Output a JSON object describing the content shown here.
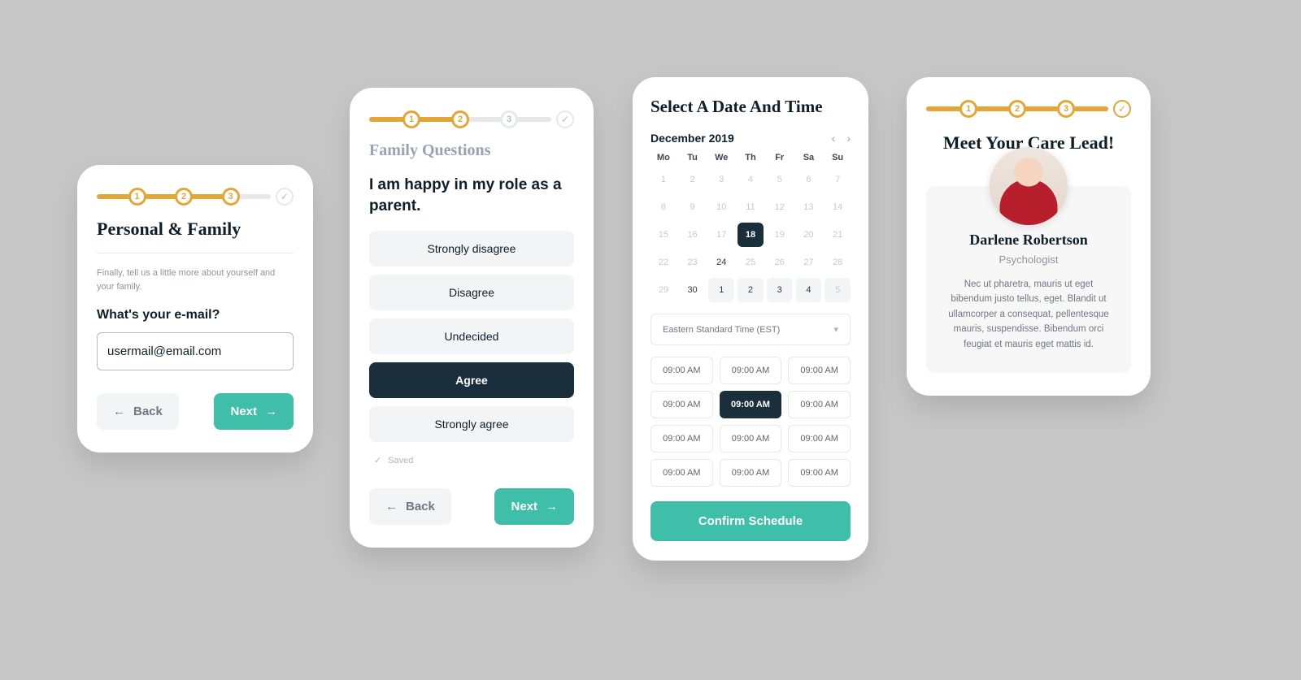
{
  "progress": {
    "s1": "1",
    "s2": "2",
    "s3": "3"
  },
  "nav": {
    "back": "Back",
    "next": "Next"
  },
  "card1": {
    "title": "Personal & Family",
    "subtitle": "Finally, tell us a little more about yourself and your family.",
    "question": "What's your e-mail?",
    "email": "usermail@email.com"
  },
  "card2": {
    "title": "Family Questions",
    "statement": "I am happy in my role as a parent.",
    "options": [
      "Strongly disagree",
      "Disagree",
      "Undecided",
      "Agree",
      "Strongly agree"
    ],
    "selected": 3,
    "saved": "Saved"
  },
  "card3": {
    "title": "Select A Date And Time",
    "month": "December 2019",
    "dow": [
      "Mo",
      "Tu",
      "We",
      "Th",
      "Fr",
      "Sa",
      "Su"
    ],
    "weeks": [
      [
        {
          "n": 1,
          "s": "dim"
        },
        {
          "n": 2,
          "s": "dim"
        },
        {
          "n": 3,
          "s": "dim"
        },
        {
          "n": 4,
          "s": "dim"
        },
        {
          "n": 5,
          "s": "dim"
        },
        {
          "n": 6,
          "s": "dim"
        },
        {
          "n": 7,
          "s": "dim"
        }
      ],
      [
        {
          "n": 8,
          "s": "dim"
        },
        {
          "n": 9,
          "s": "dim"
        },
        {
          "n": 10,
          "s": "dim"
        },
        {
          "n": 11,
          "s": "dim"
        },
        {
          "n": 12,
          "s": "dim"
        },
        {
          "n": 13,
          "s": "dim"
        },
        {
          "n": 14,
          "s": "dim"
        }
      ],
      [
        {
          "n": 15,
          "s": "dim"
        },
        {
          "n": 16,
          "s": "dim"
        },
        {
          "n": 17,
          "s": "dim"
        },
        {
          "n": 18,
          "s": "sel"
        },
        {
          "n": 19,
          "s": "dim"
        },
        {
          "n": 20,
          "s": "dim"
        },
        {
          "n": 21,
          "s": "dim"
        }
      ],
      [
        {
          "n": 22,
          "s": "dim"
        },
        {
          "n": 23,
          "s": "dim"
        },
        {
          "n": 24,
          "s": ""
        },
        {
          "n": 25,
          "s": "dim"
        },
        {
          "n": 26,
          "s": "dim"
        },
        {
          "n": 27,
          "s": "dim"
        },
        {
          "n": 28,
          "s": "dim"
        }
      ],
      [
        {
          "n": 29,
          "s": "dim"
        },
        {
          "n": 30,
          "s": ""
        },
        {
          "n": 1,
          "s": "av"
        },
        {
          "n": 2,
          "s": "av"
        },
        {
          "n": 3,
          "s": "av"
        },
        {
          "n": 4,
          "s": "av"
        },
        {
          "n": 5,
          "s": "av dim"
        }
      ]
    ],
    "timezone": "Eastern Standard Time (EST)",
    "slots": [
      "09:00 AM",
      "09:00 AM",
      "09:00 AM",
      "09:00 AM",
      "09:00 AM",
      "09:00 AM",
      "09:00 AM",
      "09:00 AM",
      "09:00 AM",
      "09:00 AM",
      "09:00 AM",
      "09:00 AM"
    ],
    "slotSelected": 4,
    "confirm": "Confirm Schedule"
  },
  "card4": {
    "title": "Meet Your Care Lead!",
    "name": "Darlene Robertson",
    "role": "Psychologist",
    "bio": "Nec ut pharetra, mauris ut eget bibendum justo tellus, eget. Blandit ut ullamcorper a consequat, pellentesque mauris, suspendisse. Bibendum orci feugiat et mauris eget mattis id."
  }
}
